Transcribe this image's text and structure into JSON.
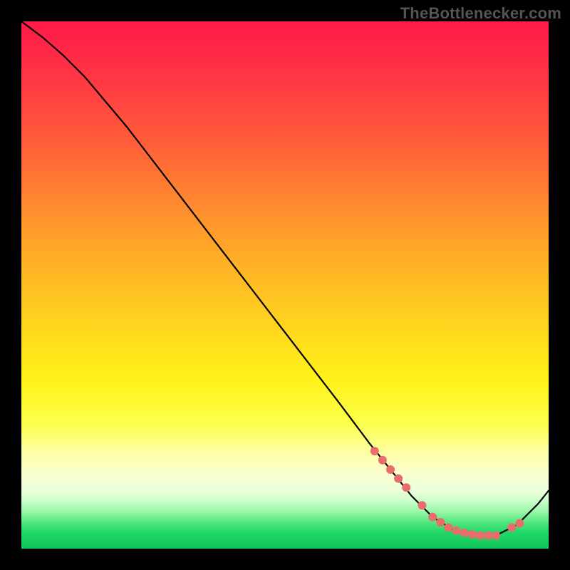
{
  "watermark": "TheBottlenecker.com",
  "chart_data": {
    "type": "line",
    "title": "",
    "xlabel": "",
    "ylabel": "",
    "xlim": [
      0,
      100
    ],
    "ylim": [
      0,
      100
    ],
    "series": [
      {
        "name": "curve",
        "x": [
          0,
          4,
          8,
          12,
          20,
          30,
          40,
          50,
          60,
          66,
          70,
          74,
          78,
          82,
          86,
          90,
          94,
          98,
          100
        ],
        "y": [
          100,
          97,
          93.5,
          89.5,
          80,
          67,
          54,
          41,
          28,
          20,
          15,
          10,
          6,
          3.5,
          2.5,
          2.5,
          4.5,
          8.5,
          11
        ]
      }
    ],
    "markers": {
      "name": "highlighted-points",
      "color": "#e96d6d",
      "x": [
        67,
        68.5,
        70,
        71.5,
        73,
        76,
        78,
        79.5,
        81,
        82.5,
        84,
        85.5,
        87,
        88.5,
        90,
        93,
        94.5
      ],
      "y": [
        18.5,
        16.8,
        15,
        13.3,
        11.6,
        8.2,
        6,
        5,
        4,
        3.4,
        3,
        2.7,
        2.5,
        2.5,
        2.5,
        4,
        4.8
      ]
    }
  }
}
